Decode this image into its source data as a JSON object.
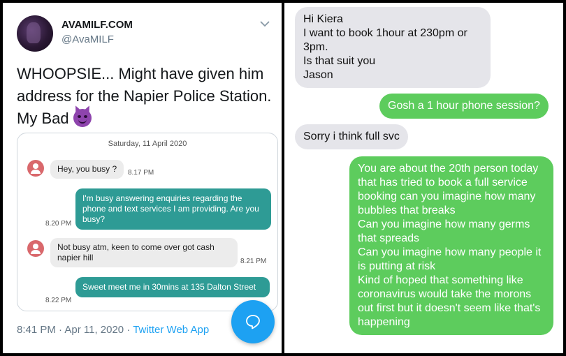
{
  "tweet": {
    "display_name": "AVAMILF.COM",
    "handle": "@AvaMILF",
    "text": "WHOOPSIE... Might have given him address for the Napier Police Station.  My Bad",
    "emoji": "smiling-face-with-horns",
    "timestamp": "8:41 PM · Apr 11, 2020 · ",
    "source_app": "Twitter Web App"
  },
  "sms_screenshot": {
    "date": "Saturday, 11 April 2020",
    "messages": [
      {
        "direction": "in",
        "text": "Hey, you busy ?",
        "time": "8.17 PM"
      },
      {
        "direction": "out",
        "text": "I'm busy answering enquiries regarding the phone and text services I am providing.   Are you busy?",
        "time": "8.20 PM"
      },
      {
        "direction": "in",
        "text": "Not busy atm, keen to come over got cash napier hill",
        "time": "8.21 PM"
      },
      {
        "direction": "out",
        "text": "Sweet meet me in 30mins at 135 Dalton Street",
        "time": "8.22 PM"
      }
    ]
  },
  "text_thread": {
    "messages": [
      {
        "direction": "in",
        "text": "Hi Kiera\nI want to book 1hour at 230pm or 3pm.\nIs that suit you\nJason"
      },
      {
        "direction": "out",
        "text": "Gosh a 1 hour phone session?"
      },
      {
        "direction": "in",
        "text": "Sorry i think full svc"
      },
      {
        "direction": "out",
        "text": "You are about the 20th person today that has tried to book a full service booking can you imagine how many bubbles that breaks\nCan you imagine how many germs that spreads\nCan you imagine how many people it is putting at risk\nKind of hoped that something like coronavirus would take the morons out first but it doesn't seem like that's happening"
      }
    ]
  },
  "colors": {
    "twitter_blue": "#1da1f2",
    "sms_outgoing": "#2e9b95",
    "imessage_green": "#5dcc5d",
    "imessage_gray": "#e5e5ea"
  }
}
